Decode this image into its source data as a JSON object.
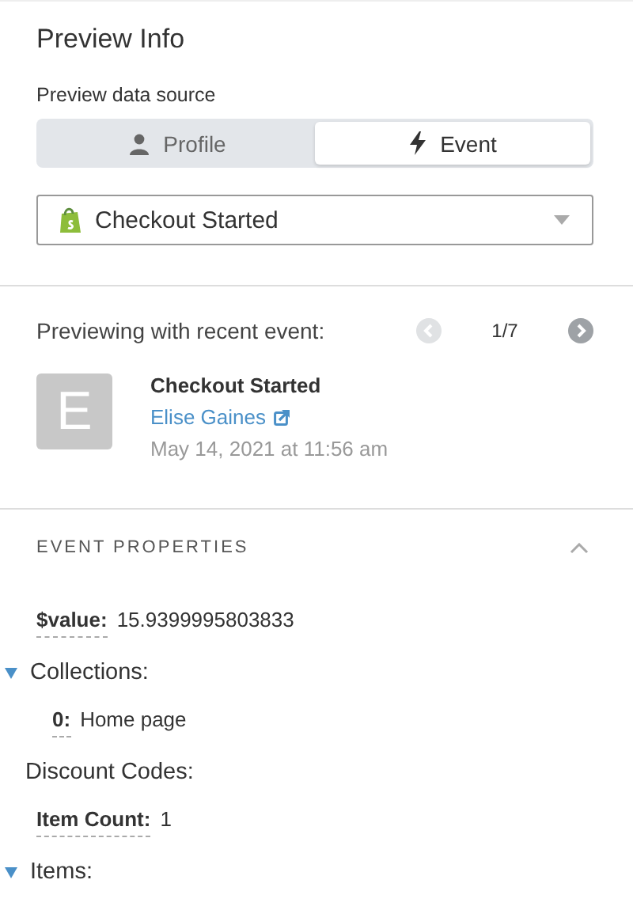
{
  "title": "Preview Info",
  "source": {
    "label": "Preview data source",
    "tabs": [
      {
        "label": "Profile",
        "kind": "profile",
        "selected": false
      },
      {
        "label": "Event",
        "kind": "event",
        "selected": true
      }
    ]
  },
  "event_select": {
    "value": "Checkout Started"
  },
  "recent": {
    "label": "Previewing with recent event:",
    "counter": "1/7",
    "prev_disabled": true,
    "next_disabled": false,
    "event": {
      "avatar": "E",
      "name": "Checkout Started",
      "person": "Elise Gaines",
      "time": "May 14, 2021 at 11:56 am"
    }
  },
  "properties": {
    "heading": "EVENT PROPERTIES",
    "expanded": true,
    "items": [
      {
        "kind": "field",
        "key": "$value:",
        "value": "15.9399995803833"
      },
      {
        "kind": "group",
        "label": "Collections:",
        "expanded": true,
        "children": [
          {
            "key": "0:",
            "value": "Home page"
          }
        ]
      },
      {
        "kind": "heading",
        "label": "Discount Codes:"
      },
      {
        "kind": "field",
        "key": "Item Count:",
        "value": "1"
      },
      {
        "kind": "group",
        "label": "Items:",
        "expanded": true
      }
    ]
  }
}
